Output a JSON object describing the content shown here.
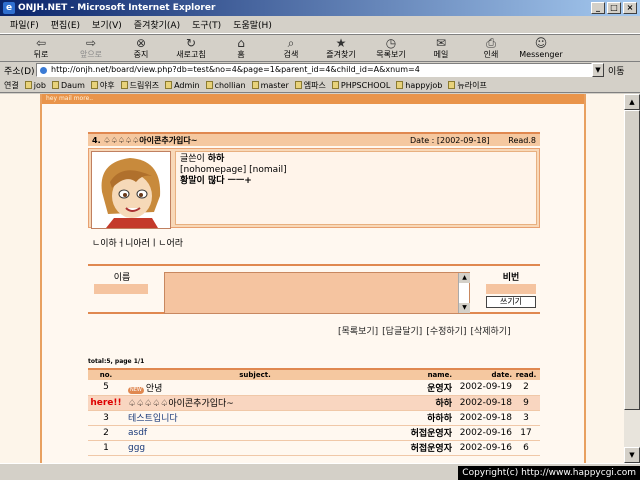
{
  "window": {
    "title": "ONJH.NET - Microsoft Internet Explorer",
    "controls": [
      "_",
      "□",
      "×"
    ]
  },
  "menu": [
    "파일(F)",
    "편집(E)",
    "보기(V)",
    "즐겨찾기(A)",
    "도구(T)",
    "도움말(H)"
  ],
  "toolbar": [
    {
      "icon": "back-icon",
      "glyph": "⇦",
      "label": "뒤로",
      "enabled": true
    },
    {
      "icon": "forward-icon",
      "glyph": "⇨",
      "label": "앞으로",
      "enabled": false
    },
    {
      "icon": "stop-icon",
      "glyph": "⊗",
      "label": "중지",
      "enabled": true
    },
    {
      "icon": "refresh-icon",
      "glyph": "↻",
      "label": "새로고침",
      "enabled": true
    },
    {
      "icon": "home-icon",
      "glyph": "⌂",
      "label": "홈",
      "enabled": true
    },
    {
      "icon": "search-icon",
      "glyph": "⌕",
      "label": "검색",
      "enabled": true
    },
    {
      "icon": "favorites-icon",
      "glyph": "★",
      "label": "즐겨찾기",
      "enabled": true
    },
    {
      "icon": "history-icon",
      "glyph": "◷",
      "label": "목록보기",
      "enabled": true
    },
    {
      "icon": "mail-icon",
      "glyph": "✉",
      "label": "메일",
      "enabled": true
    },
    {
      "icon": "print-icon",
      "glyph": "⎙",
      "label": "인쇄",
      "enabled": true
    },
    {
      "icon": "messenger-icon",
      "glyph": "☺",
      "label": "Messenger",
      "enabled": true
    }
  ],
  "address": {
    "label": "주소(D)",
    "url": "http://onjh.net/board/view.php?db=test&no=4&page=1&parent_id=4&child_id=A&xnum=4",
    "go_label": "이동"
  },
  "links": {
    "label": "연결",
    "items": [
      "job",
      "Daum",
      "야후",
      "드림위즈",
      "Admin",
      "chollian",
      "master",
      "엠파스",
      "PHPSCHOOL",
      "happyjob",
      "뉴라이프"
    ]
  },
  "frame_header": "hey mail more..",
  "post": {
    "title": "4. ♤♤♤♤♤아이콘추가입다~",
    "date": "Date : [2002-09-18]",
    "read": "Read.8",
    "author_label": "글쓴이",
    "author": "하하",
    "homepage": "[nohomepage]",
    "mail": "[nomail]",
    "body": "황말이 많다 ㅡㅡ+"
  },
  "comment_text": "ㄴ이하ㅓ니아러ㅣㄴ어라",
  "comment_form": {
    "name_label": "이름",
    "password_label": "비번",
    "submit_label": "쓰기기"
  },
  "actions": [
    "[목록보기]",
    "[답글달기]",
    "[수정하기]",
    "[삭제하기]"
  ],
  "list": {
    "total": "total:5, page 1/1",
    "headers": {
      "no": "no.",
      "subject": "subject.",
      "name": "name.",
      "date": "date.",
      "read": "read."
    },
    "rows": [
      {
        "no": "5",
        "new": "NEW",
        "subject": "안녕",
        "name": "운영자",
        "date": "2002-09-19",
        "read": "2"
      },
      {
        "no": "here!!",
        "subject": "♤♤♤♤♤아이콘추가입다~",
        "name": "하하",
        "date": "2002-09-18",
        "read": "9"
      },
      {
        "no": "3",
        "subject": "테스트입니다",
        "name": "하하하",
        "date": "2002-09-18",
        "read": "3"
      },
      {
        "no": "2",
        "subject": "asdf",
        "name": "허접운영자",
        "date": "2002-09-16",
        "read": "17"
      },
      {
        "no": "1",
        "subject": "ggg",
        "name": "허접운영자",
        "date": "2002-09-16",
        "read": "6"
      }
    ]
  },
  "copyright": "Copyright(c) http://www.happycgi.com"
}
